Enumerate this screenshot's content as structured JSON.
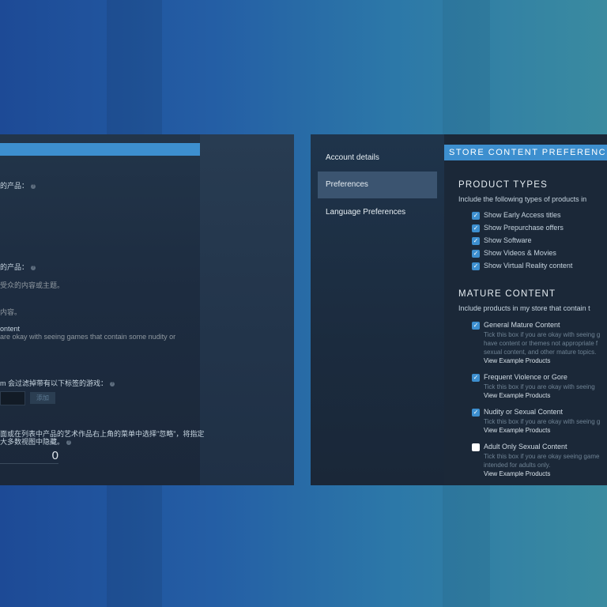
{
  "left_panel": {
    "lines": [
      "的产品：",
      "的产品：",
      "受众的内容或主题。",
      "内容。",
      "ontent",
      "are okay with seeing games that contain some nudity or",
      "m 会过滤掉带有以下标签的游戏：",
      "面或在列表中产品的艺术作品右上角的菜单中选择\"忽略\"，将指定",
      "大多数视图中隐藏。"
    ],
    "add_button": "添加",
    "ignored_count": "0"
  },
  "nav": {
    "items": [
      {
        "label": "Account details"
      },
      {
        "label": "Preferences"
      },
      {
        "label": "Language Preferences"
      }
    ]
  },
  "content": {
    "header": "STORE CONTENT PREFERENCES",
    "product_types": {
      "title": "PRODUCT TYPES",
      "description": "Include the following types of products in",
      "options": [
        {
          "label": "Show Early Access titles",
          "checked": true
        },
        {
          "label": "Show Prepurchase offers",
          "checked": true
        },
        {
          "label": "Show Software",
          "checked": true
        },
        {
          "label": "Show Videos & Movies",
          "checked": true
        },
        {
          "label": "Show Virtual Reality content",
          "checked": true
        }
      ]
    },
    "mature": {
      "title": "MATURE CONTENT",
      "description": "Include products in my store that contain t",
      "options": [
        {
          "label": "General Mature Content",
          "checked": true,
          "desc": [
            "Tick this box if you are okay with seeing g",
            "have content or themes not appropriate f",
            "sexual content, and other mature topics."
          ],
          "link": "View Example Products"
        },
        {
          "label": "Frequent Violence or Gore",
          "checked": true,
          "desc": [
            "Tick this box if you are okay with seeing"
          ],
          "link": "View Example Products"
        },
        {
          "label": "Nudity or Sexual Content",
          "checked": true,
          "desc": [
            "Tick this box if you are okay with seeing g"
          ],
          "link": "View Example Products"
        },
        {
          "label": "Adult Only Sexual Content",
          "checked": false,
          "desc": [
            "Tick this box if you are okay seeing game",
            "intended for adults only."
          ],
          "link": "View Example Products"
        }
      ]
    }
  },
  "colors": {
    "accent": "#3d8fcf",
    "panel_bg": "#1b2838",
    "nav_active": "#3b5470"
  }
}
